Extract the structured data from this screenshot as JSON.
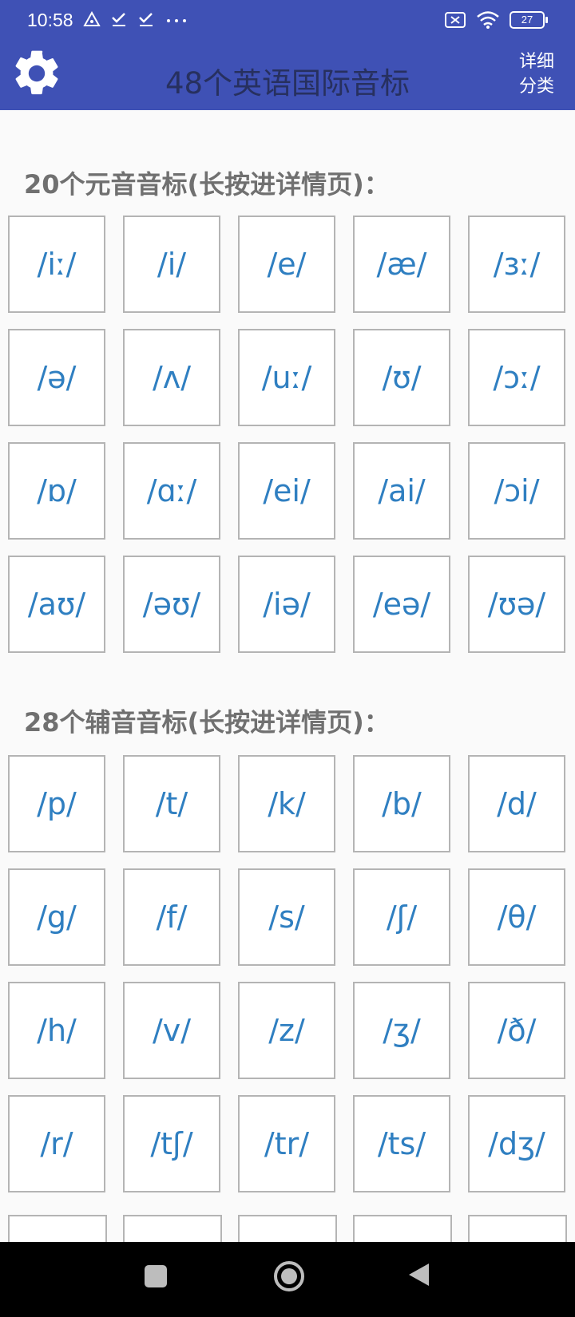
{
  "status_bar": {
    "time": "10:58",
    "battery": "27",
    "left_icons": [
      "warning-triangle-icon",
      "check-icon",
      "check-icon",
      "more-dots-icon"
    ],
    "right_icons": [
      "no-sim-icon",
      "wifi-icon",
      "battery-icon"
    ]
  },
  "app_bar": {
    "title": "48个英语国际音标",
    "detail_label_line1": "详细",
    "detail_label_line2": "分类",
    "settings_icon": "gear-icon",
    "color": "#3f51b5"
  },
  "vowels": {
    "heading": "20个元音音标(长按进详情页)：",
    "items": [
      "/iː/",
      "/i/",
      "/e/",
      "/æ/",
      "/ɜː/",
      "/ə/",
      "/ʌ/",
      "/uː/",
      "/ʊ/",
      "/ɔː/",
      "/ɒ/",
      "/ɑː/",
      "/ei/",
      "/ai/",
      "/ɔi/",
      "/aʊ/",
      "/əʊ/",
      "/iə/",
      "/eə/",
      "/ʊə/"
    ]
  },
  "consonants": {
    "heading": "28个辅音音标(长按进详情页)：",
    "items": [
      "/p/",
      "/t/",
      "/k/",
      "/b/",
      "/d/",
      "/g/",
      "/f/",
      "/s/",
      "/ʃ/",
      "/θ/",
      "/h/",
      "/v/",
      "/z/",
      "/ʒ/",
      "/ð/",
      "/r/",
      "/tʃ/",
      "/tr/",
      "/ts/",
      "/dʒ/"
    ]
  },
  "nav_bar": {
    "icons": [
      "recent-apps-icon",
      "home-icon",
      "back-icon"
    ]
  },
  "colors": {
    "accent": "#3f51b5",
    "symbol_text": "#2f7fc1",
    "heading_text": "#707070"
  }
}
